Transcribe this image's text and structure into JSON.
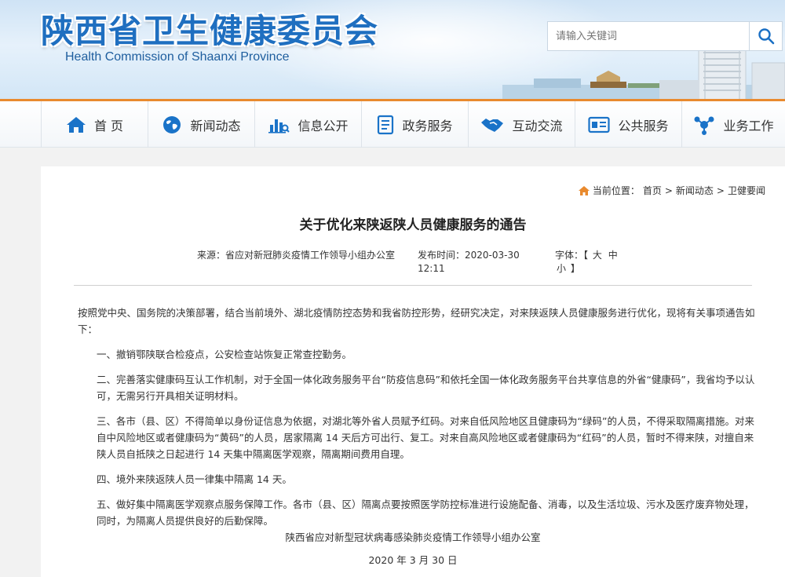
{
  "header": {
    "site_title": "陕西省卫生健康委员会",
    "site_subtitle": "Health Commission of Shaanxi Province",
    "search_placeholder": "请输入关键词"
  },
  "nav": [
    {
      "label": "首 页",
      "icon": "home-icon"
    },
    {
      "label": "新闻动态",
      "icon": "globe-icon"
    },
    {
      "label": "信息公开",
      "icon": "chart-icon"
    },
    {
      "label": "政务服务",
      "icon": "document-icon"
    },
    {
      "label": "互动交流",
      "icon": "handshake-icon"
    },
    {
      "label": "公共服务",
      "icon": "id-card-icon"
    },
    {
      "label": "业务工作",
      "icon": "network-icon"
    }
  ],
  "breadcrumb": {
    "prefix": "当前位置：",
    "items": [
      "首页",
      "新闻动态",
      "卫健要闻"
    ],
    "sep": ">"
  },
  "article": {
    "title": "关于优化来陕返陕人员健康服务的通告",
    "source_label": "来源：",
    "source": "省应对新冠肺炎疫情工作领导小组办公室",
    "time_label": "发布时间：",
    "time": "2020-03-30 12:11",
    "font_label": "字体：",
    "font_open": "【",
    "font_large": "大",
    "font_medium": "中",
    "font_small": "小",
    "font_close": "】",
    "paragraphs": [
      "按照党中央、国务院的决策部署，结合当前境外、湖北疫情防控态势和我省防控形势，经研究决定，对来陕返陕人员健康服务进行优化，现将有关事项通告如下：",
      "一、撤销鄂陕联合检疫点，公安检查站恢复正常查控勤务。",
      "二、完善落实健康码互认工作机制，对于全国一体化政务服务平台“防疫信息码”和依托全国一体化政务服务平台共享信息的外省“健康码”，我省均予以认可，无需另行开具相关证明材料。",
      "三、各市（县、区）不得简单以身份证信息为依据，对湖北等外省人员赋予红码。对来自低风险地区且健康码为“绿码”的人员，不得采取隔离措施。对来自中风险地区或者健康码为“黄码”的人员，居家隔离 14 天后方可出行、复工。对来自高风险地区或者健康码为“红码”的人员，暂时不得来陕，对擅自来陕人员自抵陕之日起进行 14 天集中隔离医学观察，隔离期间费用自理。",
      "四、境外来陕返陕人员一律集中隔离 14 天。",
      "五、做好集中隔离医学观察点服务保障工作。各市（县、区）隔离点要按照医学防控标准进行设施配备、消毒，以及生活垃圾、污水及医疗废弃物处理，同时，为隔离人员提供良好的后勤保障。"
    ],
    "signature": "陕西省应对新型冠状病毒感染肺炎疫情工作领导小组办公室",
    "date": "2020 年 3 月 30 日"
  },
  "colors": {
    "brand_blue": "#1f6fc0",
    "accent_orange": "#e98a2e",
    "icon_blue": "#1a73c8"
  }
}
